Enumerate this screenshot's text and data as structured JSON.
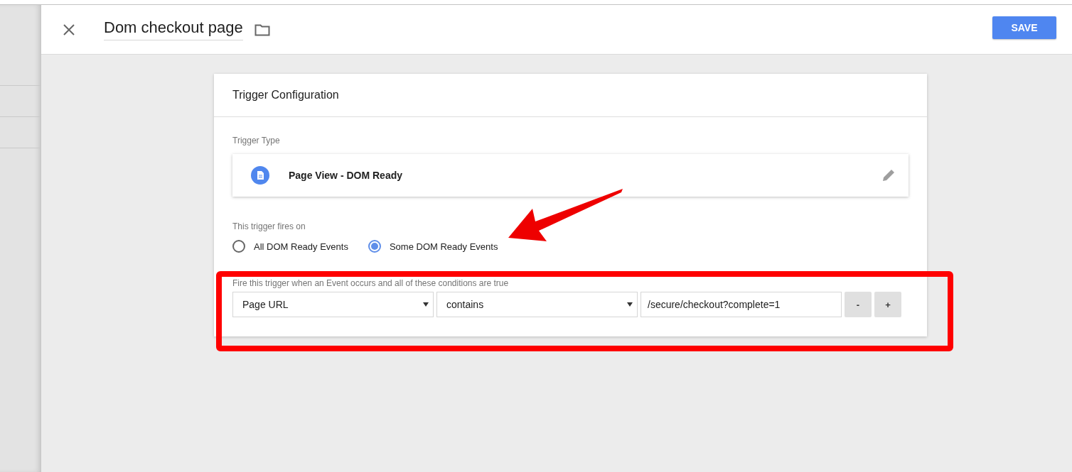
{
  "header": {
    "title": "Dom checkout page",
    "save_label": "SAVE"
  },
  "card": {
    "title": "Trigger Configuration",
    "trigger_type_label": "Trigger Type",
    "trigger_type": {
      "name": "Page View - DOM Ready"
    },
    "fires_on_label": "This trigger fires on",
    "fires_on_options": [
      {
        "label": "All DOM Ready Events",
        "selected": false
      },
      {
        "label": "Some DOM Ready Events",
        "selected": true
      }
    ],
    "conditions": {
      "caption": "Fire this trigger when an Event occurs and all of these conditions are true",
      "rows": [
        {
          "variable": "Page URL",
          "operator": "contains",
          "value": "/secure/checkout?complete=1",
          "remove_label": "-",
          "add_label": "+"
        }
      ]
    }
  }
}
